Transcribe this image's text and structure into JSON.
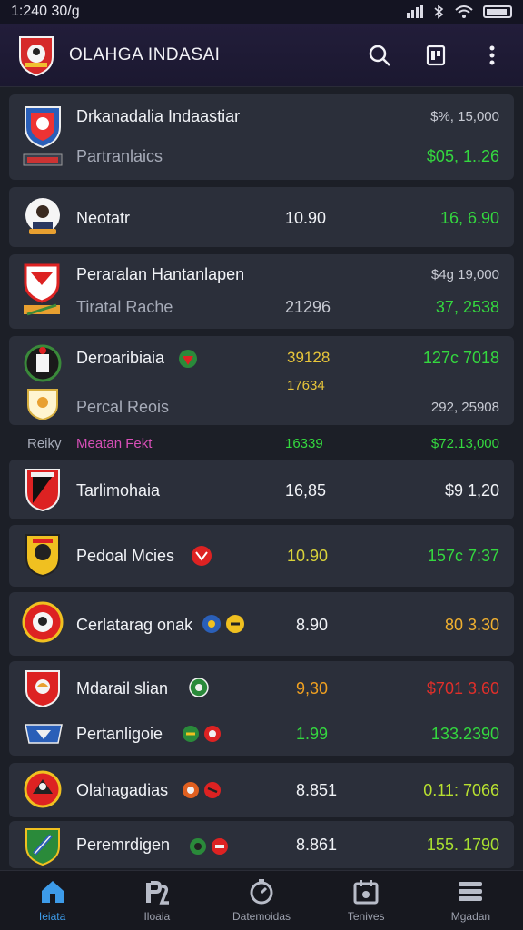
{
  "status": {
    "time": "1:240 30/g"
  },
  "app": {
    "title": "OLAHGA INDASAI"
  },
  "rows": [
    {
      "name": "Drkanadalia Indaastiar",
      "sub": "Partranlaics",
      "price_top": "$%, 15,000",
      "price": "$05, 1..26"
    },
    {
      "name": "Neotatr",
      "value": "10.90",
      "price": "16, 6.90"
    },
    {
      "name": "Peraralan Hantanlapen",
      "sub": "Tiratal Rache",
      "sub_value": "21296",
      "price_top": "$4g 19,000",
      "price": "37, 2538"
    },
    {
      "name": "Deroaribiaia",
      "value": "39128",
      "value2": "17634",
      "sub": "Percal Reois",
      "price": "127c 7018",
      "price_bottom": "292, 25908"
    },
    {
      "name": "Reiky",
      "sub": "Meatan Fekt",
      "value": "16339",
      "price": "$72.13,000"
    },
    {
      "name": "Tarlimohaia",
      "value": "16,85",
      "price": "$9   1,20"
    },
    {
      "name": "Pedoal Mcies",
      "value": "10.90",
      "price": "157c 7:37"
    },
    {
      "name": "Cerlatarag onak",
      "value": "8.90",
      "price": "80   3.30"
    },
    {
      "name": "Mdarail slian",
      "value": "9,30",
      "price": "$701 3.60",
      "sub": "Pertanligoie",
      "sub_value": "1.99",
      "price_bottom": "133.2390"
    },
    {
      "name": "Olahagadias",
      "value": "8.851",
      "price": "0.11: 7066"
    },
    {
      "name": "Peremrdigen",
      "value": "8.861",
      "price": "155. 1790"
    }
  ],
  "nav": [
    {
      "label": "Ieiata",
      "icon": "home-icon"
    },
    {
      "label": "Iloaia",
      "icon": "chart-icon"
    },
    {
      "label": "Datemoidas",
      "icon": "timer-icon"
    },
    {
      "label": "Tenives",
      "icon": "calendar-icon"
    },
    {
      "label": "Mgadan",
      "icon": "menu-icon"
    }
  ],
  "colors": {
    "green": "#34d83f",
    "yellow": "#d8d23a",
    "orange": "#f0a020",
    "red": "#e02f2a",
    "accent": "#3d9be9"
  }
}
